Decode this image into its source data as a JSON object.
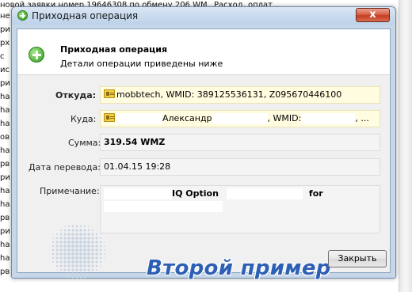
{
  "background": {
    "top_line_1": "новой заявки номер 19646308 по обмену 206 WM...",
    "top_line_2": "Расход, оплат...",
    "left_rows": [
      "не",
      "ри",
      "рх",
      "с",
      "ис",
      "ри",
      "ha",
      "ha",
      "ha",
      "ов",
      "ha",
      "рв",
      "ри",
      "ha",
      "ha",
      "рв",
      "ри",
      "ha",
      "ha",
      "рв"
    ]
  },
  "window": {
    "title": "Приходная операция",
    "close_glyph": "x"
  },
  "header": {
    "title": "Приходная операция",
    "subtitle": "Детали операции приведены ниже"
  },
  "details": {
    "from_label": "Откуда:",
    "from_value": "mobbtech, WMID: 389125536131, Z095670446100",
    "to_label": "Куда:",
    "to_name": "Александр",
    "to_wmid_label": ", WMID:",
    "to_tail": ", ...",
    "amount_label": "Сумма:",
    "amount_value": "319.54 WMZ",
    "date_label": "Дата перевода:",
    "date_value": "01.04.15 19:28",
    "note_label": "Примечание:",
    "note_part1": "IQ Option",
    "note_part2": "for"
  },
  "watermark": {
    "text": "Второй пример"
  },
  "buttons": {
    "close_label": "Закрыть"
  },
  "colors": {
    "window_frame": "#c6d7ea",
    "title_close": "#c43d21",
    "highlight_field": "#fffce0",
    "watermark_text": "#2d5fb4",
    "accent_green": "#2f9c1d"
  },
  "icons": {
    "window_icon": "green-plus-circle-icon",
    "header_icon": "green-plus-circle-icon",
    "wmid_icon": "wm-passport-card-icon",
    "logo": "dotted-globe-logo"
  }
}
